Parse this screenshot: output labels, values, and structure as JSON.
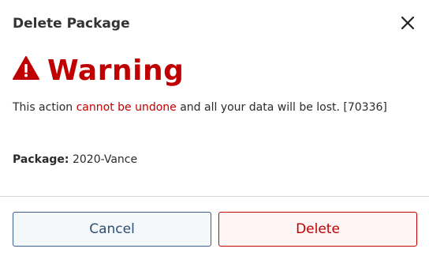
{
  "dialog": {
    "title": "Delete Package",
    "close_icon": "close-icon"
  },
  "warning": {
    "icon": "warning-triangle-icon",
    "heading": "Warning",
    "color": "#c00000"
  },
  "message": {
    "prefix": "This action ",
    "emphasis": "cannot be undone",
    "suffix": " and all your data will be lost. [70336]"
  },
  "package": {
    "label": "Package:",
    "value": "2020-Vance"
  },
  "buttons": {
    "cancel_label": "Cancel",
    "delete_label": "Delete"
  }
}
